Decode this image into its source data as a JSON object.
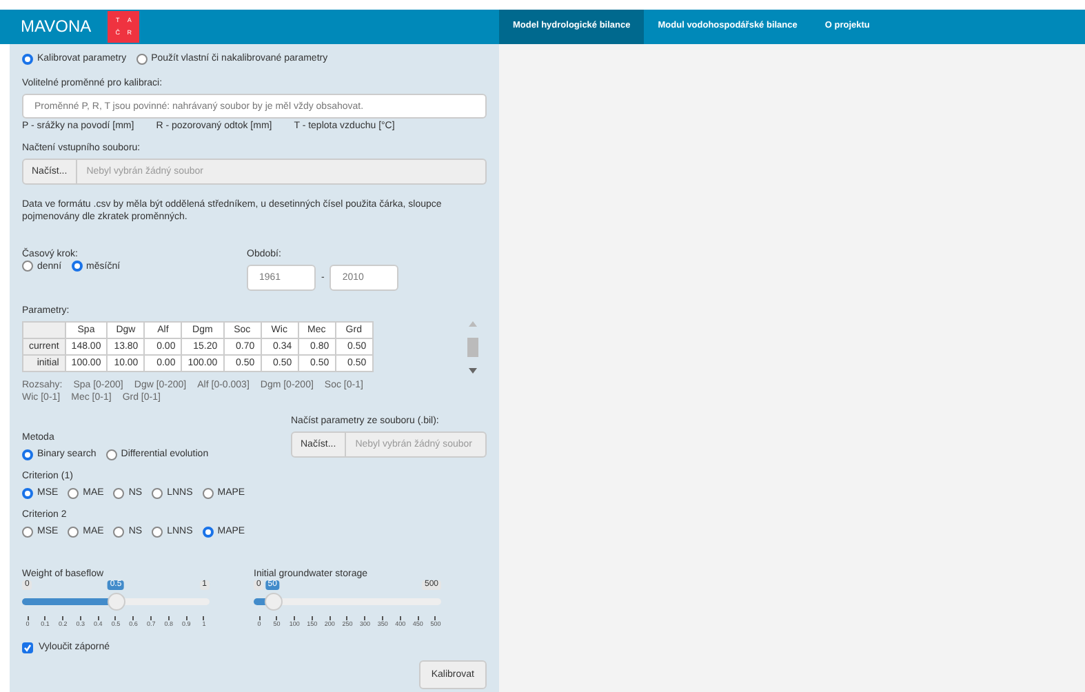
{
  "brand": {
    "title": "MAVONA",
    "logo_letters": [
      "T",
      "A",
      "Č",
      "R"
    ]
  },
  "nav_tabs": [
    {
      "label": "Model hydrologické bilance",
      "selected": true
    },
    {
      "label": "Modul vodohospodářské bilance",
      "selected": false
    },
    {
      "label": "O projektu",
      "selected": false
    }
  ],
  "mode": [
    {
      "label": "Kalibrovat parametry",
      "selected": true
    },
    {
      "label": "Použít vlastní či nakalibrované parametry",
      "selected": false
    }
  ],
  "optional_vars": {
    "label": "Volitelné proměnné pro kalibraci:",
    "placeholder": "Proměnné P, R, T jsou povinné: nahrávaný soubor by je měl vždy obsahovat.",
    "hints": [
      "P - srážky na povodí [mm]",
      "R - pozorovaný odtok [mm]",
      "T - teplota vzduchu [°C]"
    ]
  },
  "input_file": {
    "label": "Načtení vstupního souboru:",
    "button": "Načíst...",
    "placeholder": "Nebyl vybrán žádný soubor"
  },
  "note": "Data ve formátu .csv by měla být oddělená středníkem, u desetinných čísel použita čárka, sloupce pojmenovány dle zkratek proměnných.",
  "time_step": {
    "label": "Časový krok:",
    "options": [
      {
        "label": "denní",
        "selected": false
      },
      {
        "label": "měsíční",
        "selected": true
      }
    ]
  },
  "period": {
    "label": "Období:",
    "from": "1961",
    "separator": "-",
    "to": "2010"
  },
  "parameters": {
    "label": "Parametry:",
    "columns": [
      "Spa",
      "Dgw",
      "Alf",
      "Dgm",
      "Soc",
      "Wic",
      "Mec",
      "Grd"
    ],
    "rows": [
      {
        "name": "current",
        "values": [
          "148.00",
          "13.80",
          "0.00",
          "15.20",
          "0.70",
          "0.34",
          "0.80",
          "0.50"
        ]
      },
      {
        "name": "initial",
        "values": [
          "100.00",
          "10.00",
          "0.00",
          "100.00",
          "0.50",
          "0.50",
          "0.50",
          "0.50"
        ]
      }
    ],
    "ranges_label": "Rozsahy:",
    "ranges": [
      "Spa [0-200]",
      "Dgw [0-200]",
      "Alf [0-0.003]",
      "Dgm [0-200]",
      "Soc [0-1]",
      "Wic [0-1]",
      "Mec [0-1]",
      "Grd [0-1]"
    ]
  },
  "param_file": {
    "label": "Načíst parametry ze souboru (.bil):",
    "button": "Načíst...",
    "placeholder": "Nebyl vybrán žádný soubor"
  },
  "method": {
    "label": "Metoda",
    "options": [
      {
        "label": "Binary search",
        "selected": true
      },
      {
        "label": "Differential evolution",
        "selected": false
      }
    ]
  },
  "criterion1": {
    "label": "Criterion (1)",
    "options": [
      {
        "label": "MSE",
        "selected": true
      },
      {
        "label": "MAE",
        "selected": false
      },
      {
        "label": "NS",
        "selected": false
      },
      {
        "label": "LNNS",
        "selected": false
      },
      {
        "label": "MAPE",
        "selected": false
      }
    ]
  },
  "criterion2": {
    "label": "Criterion 2",
    "options": [
      {
        "label": "MSE",
        "selected": false
      },
      {
        "label": "MAE",
        "selected": false
      },
      {
        "label": "NS",
        "selected": false
      },
      {
        "label": "LNNS",
        "selected": false
      },
      {
        "label": "MAPE",
        "selected": true
      }
    ]
  },
  "sliders": [
    {
      "label": "Weight of baseflow",
      "min": "0",
      "max": "1",
      "value": "0.5",
      "level": 0.5,
      "ticks": [
        "0",
        "0.1",
        "0.2",
        "0.3",
        "0.4",
        "0.5",
        "0.6",
        "0.7",
        "0.8",
        "0.9",
        "1"
      ]
    },
    {
      "label": "Initial groundwater storage",
      "min": "0",
      "max": "500",
      "value": "50",
      "level": 0.1,
      "ticks": [
        "0",
        "50",
        "100",
        "150",
        "200",
        "250",
        "300",
        "350",
        "400",
        "450",
        "500"
      ]
    }
  ],
  "exclude_negative": {
    "label": "Vyloučit záporné",
    "checked": true
  },
  "calibrate_button": "Kalibrovat"
}
